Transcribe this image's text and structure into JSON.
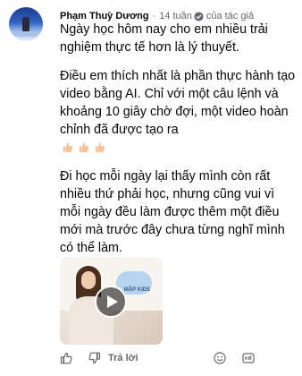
{
  "comment": {
    "author": "Phạm Thuỳ Dương",
    "separator": "·",
    "time": "14 tuần",
    "badge_label": "của tác giả",
    "paragraphs": [
      "Ngày học hôm nay cho em nhiều trải nghiệm thực tế hơn là lý thuyết.",
      "Điều em thích nhất là phần thực hành tạo video bằng AI. Chỉ với một câu lệnh và khoảng 10 giây chờ đợi, một video hoàn chỉnh đã được tạo ra",
      "Đi học mỗi ngày lại thấy mình còn rất nhiều thứ phải học, nhưng cũng vui vì mỗi ngày đều làm được thêm một điều mới mà trước đây chưa từng nghĩ mình có thể làm."
    ],
    "emoji": [
      "thumbs-up-light-skin",
      "thumbs-up-light-skin",
      "thumbs-up-light-skin"
    ],
    "video": {
      "thumbnail_text": "MẬP KIDS",
      "play_icon": "play-icon"
    },
    "actions": {
      "like_icon": "thumbs-up-outline-icon",
      "dislike_icon": "thumbs-down-outline-icon",
      "reply_label": "Trả lời",
      "emoji_icon": "smile-icon",
      "gif_icon": "gif-icon"
    }
  },
  "colors": {
    "text_primary": "#050505",
    "text_secondary": "#65676b",
    "thumb_skin": "#f2c39a"
  }
}
